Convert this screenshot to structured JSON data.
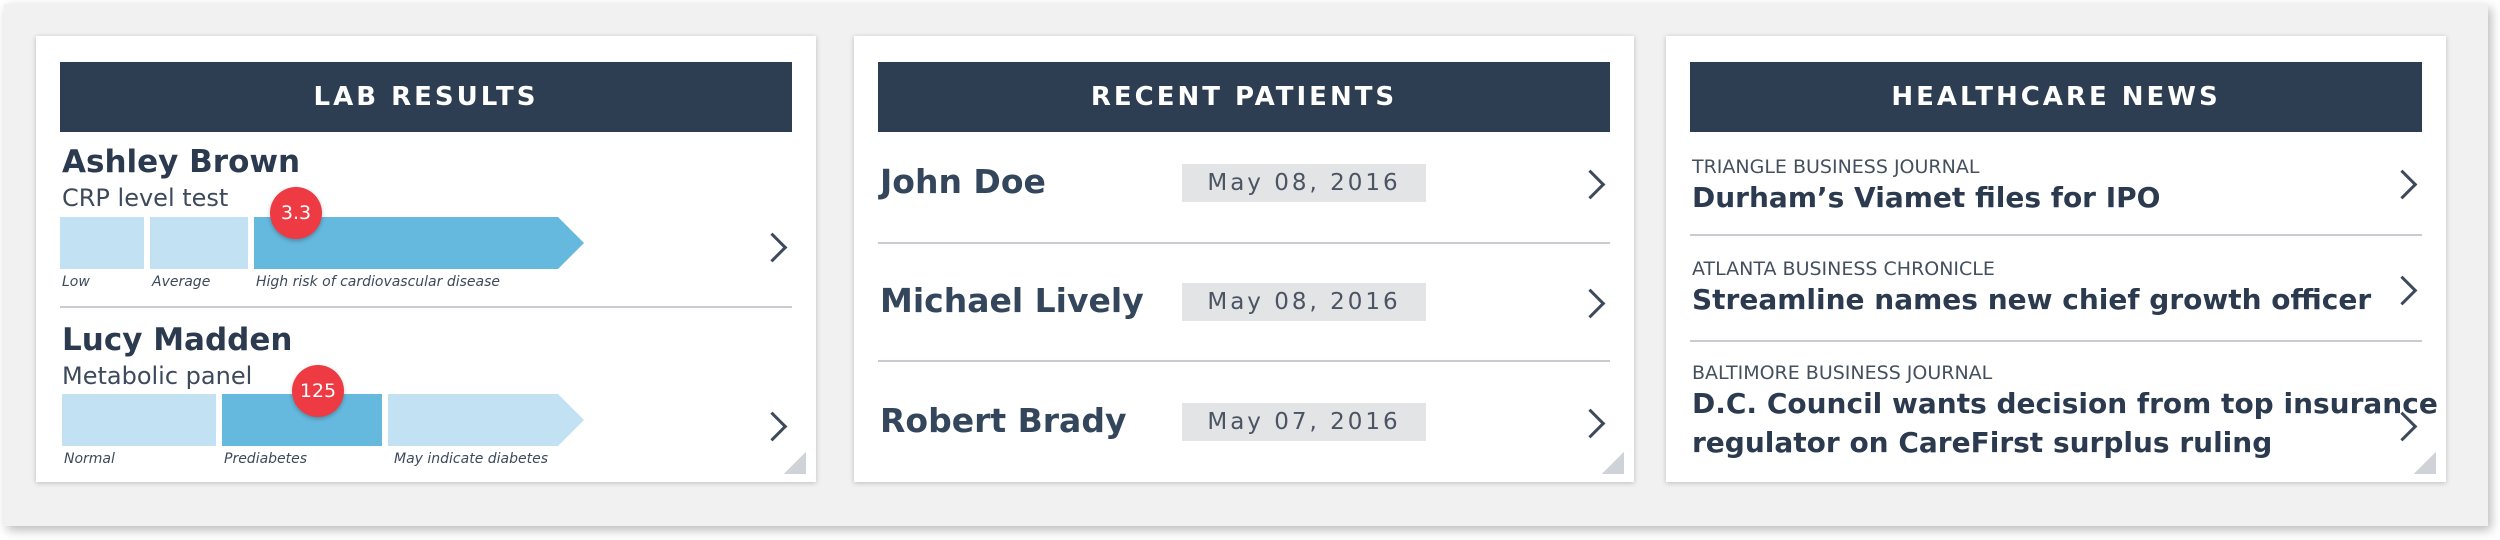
{
  "lab_results": {
    "title": "LAB RESULTS",
    "patients": [
      {
        "name": "Ashley Brown",
        "test": "CRP level test",
        "value": "3.3",
        "ranges": [
          "Low",
          "Average",
          "High risk of cardiovascular disease"
        ]
      },
      {
        "name": "Lucy Madden",
        "test": "Metabolic panel",
        "value": "125",
        "ranges": [
          "Normal",
          "Prediabetes",
          "May indicate diabetes"
        ]
      }
    ]
  },
  "recent_patients": {
    "title": "RECENT PATIENTS",
    "items": [
      {
        "name": "John Doe",
        "date": "May 08, 2016"
      },
      {
        "name": "Michael Lively",
        "date": "May 08, 2016"
      },
      {
        "name": "Robert Brady",
        "date": "May 07, 2016"
      }
    ]
  },
  "news": {
    "title": "HEALTHCARE NEWS",
    "items": [
      {
        "source": "TRIANGLE BUSINESS JOURNAL",
        "headline": "Durham’s Viamet files for IPO"
      },
      {
        "source": "ATLANTA BUSINESS CHRONICLE",
        "headline": "Streamline names new chief growth officer"
      },
      {
        "source": "BALTIMORE BUSINESS JOURNAL",
        "headline_line1": "D.C. Council wants decision from top insurance",
        "headline_line2": "regulator on CareFirst surplus ruling"
      }
    ]
  },
  "icons": {
    "row_chevron": "chevron-right-icon",
    "resize": "resize-corner-icon"
  },
  "colors": {
    "header_bg": "#2e3e52",
    "range_light": "#c2e1f2",
    "range_highlight": "#66b9de",
    "marker": "#ee3a43"
  }
}
